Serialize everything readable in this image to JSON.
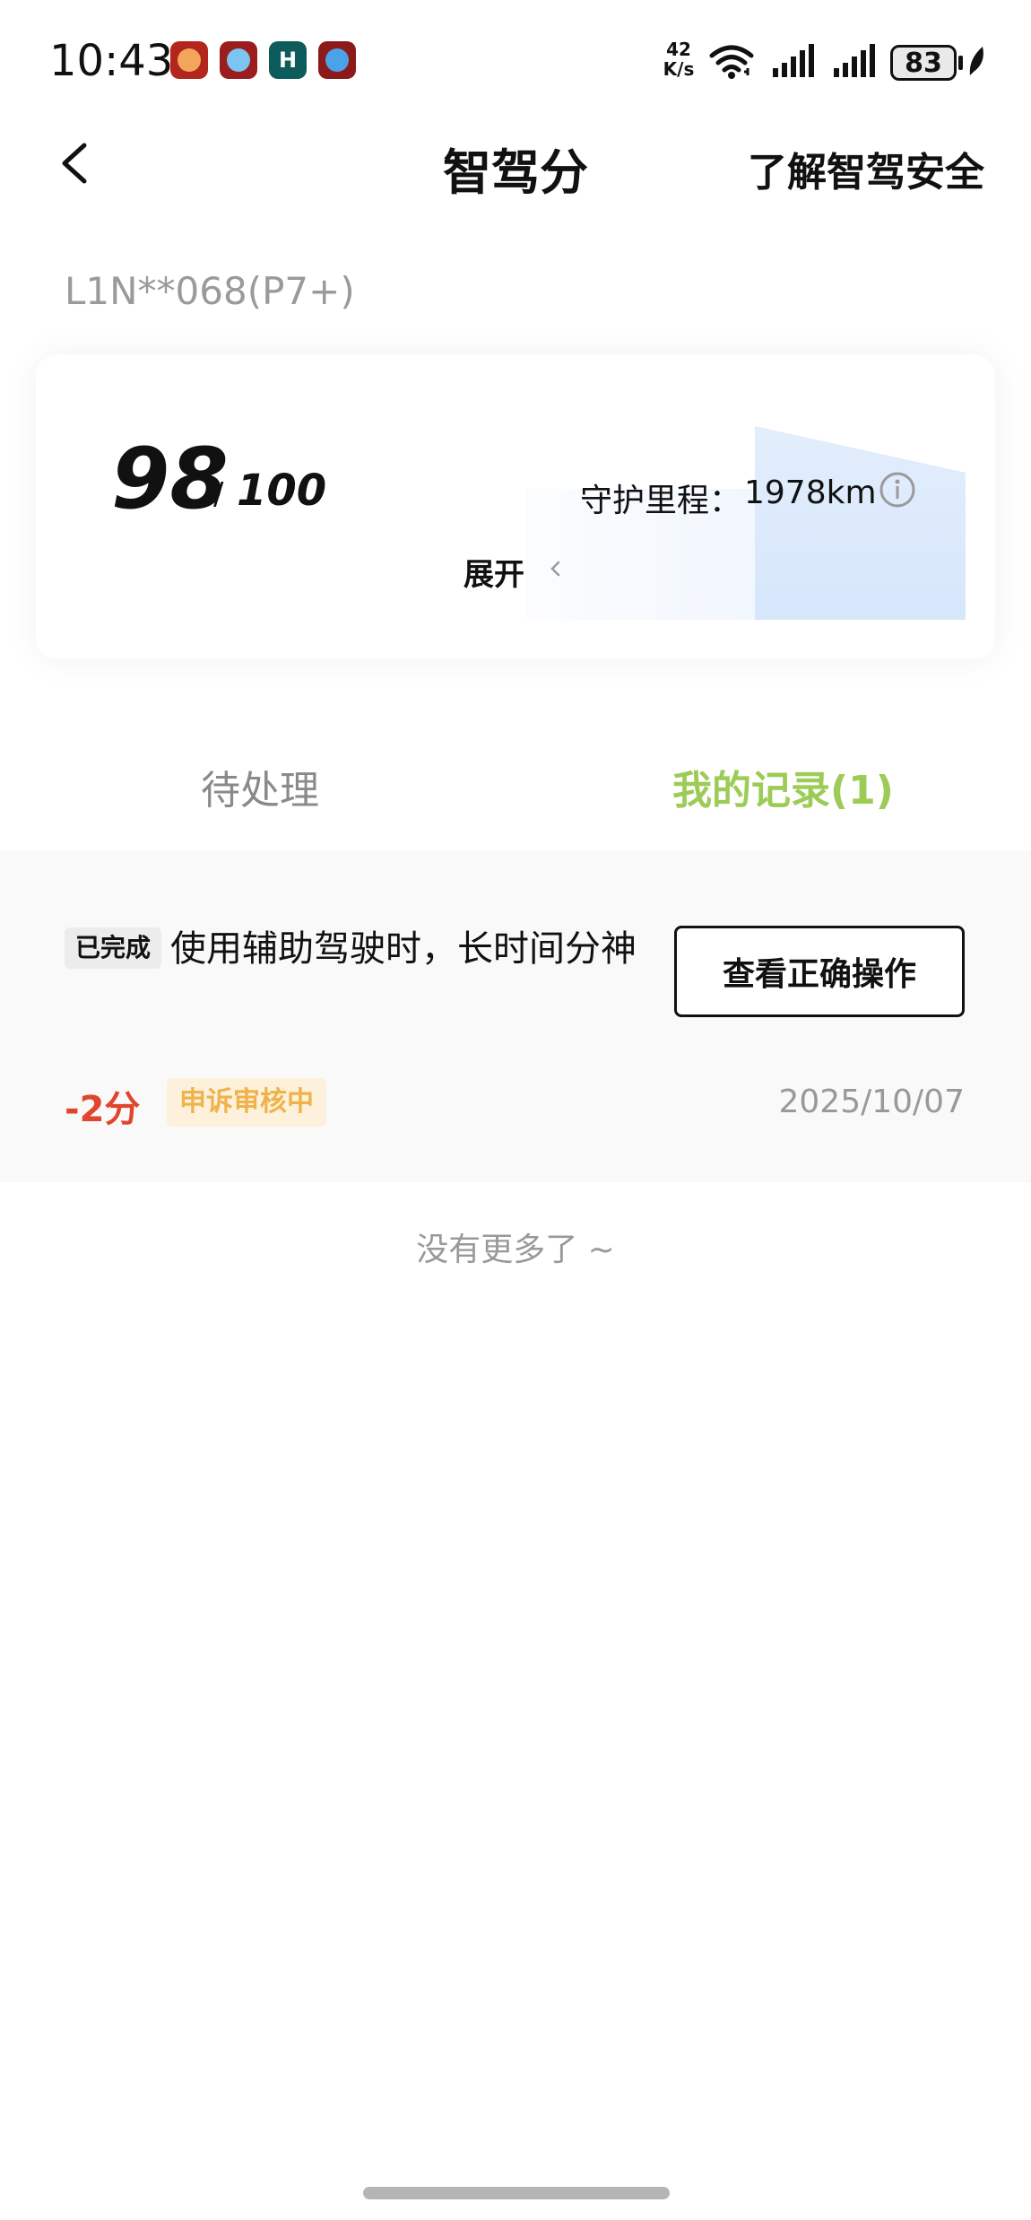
{
  "status_bar": {
    "time": "10:43",
    "net_speed_value": "42",
    "net_speed_unit": "K/s",
    "battery": "83",
    "icons": [
      "notification-app-icon",
      "cloud-app-icon",
      "h-app-icon",
      "browser-app-icon",
      "wifi-icon",
      "signal-icon",
      "signal-icon",
      "battery-icon",
      "leaf-icon"
    ]
  },
  "header": {
    "title": "智驾分",
    "link": "了解智驾安全"
  },
  "vehicle": {
    "id": "L1N**068(P7+)"
  },
  "score_card": {
    "score": "98",
    "separator": "/",
    "total": "100",
    "mileage_label": "守护里程：",
    "mileage_value": "1978km",
    "expand_label": "展开"
  },
  "tabs": [
    {
      "label": "待处理",
      "active": false
    },
    {
      "label": "我的记录(1)",
      "active": true
    }
  ],
  "records": [
    {
      "badge": "已完成",
      "title": "使用辅助驾驶时，长时间分神",
      "button": "查看正确操作",
      "points": "-2分",
      "status": "申诉审核中",
      "date": "2025/10/07"
    }
  ],
  "footer_note": "没有更多了 ~",
  "colors": {
    "accent_green": "#9ccb56",
    "penalty_red": "#e0452d",
    "status_orange": "#f0b24a",
    "status_bg": "#fdf1dc"
  }
}
